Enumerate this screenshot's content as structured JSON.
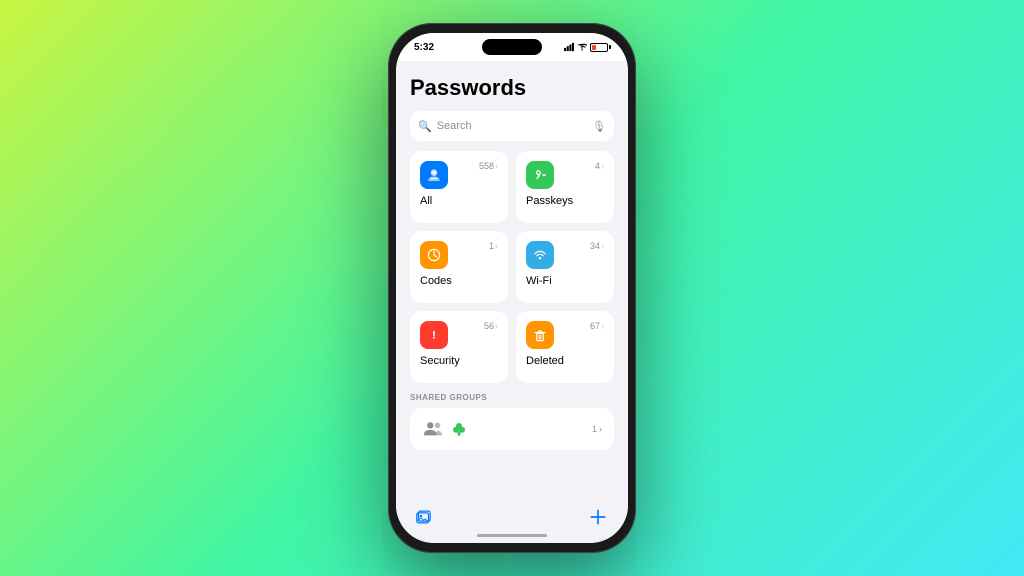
{
  "background": {
    "gradient_start": "#c8f542",
    "gradient_end": "#42e8f5"
  },
  "status_bar": {
    "time": "5:32",
    "battery_level": "low"
  },
  "page": {
    "title": "Passwords"
  },
  "search": {
    "placeholder": "Search"
  },
  "grid_items": [
    {
      "id": "all",
      "label": "All",
      "count": "558",
      "icon_color": "blue",
      "icon_char": "🔑"
    },
    {
      "id": "passkeys",
      "label": "Passkeys",
      "count": "4",
      "icon_color": "green",
      "icon_char": "🔐"
    },
    {
      "id": "codes",
      "label": "Codes",
      "count": "1",
      "icon_color": "yellow",
      "icon_char": "⏱"
    },
    {
      "id": "wifi",
      "label": "Wi-Fi",
      "count": "34",
      "icon_color": "teal",
      "icon_char": "📶"
    },
    {
      "id": "security",
      "label": "Security",
      "count": "56",
      "icon_color": "red",
      "icon_char": "⚠️"
    },
    {
      "id": "deleted",
      "label": "Deleted",
      "count": "67",
      "icon_color": "orange",
      "icon_char": "🗑"
    }
  ],
  "shared_groups": {
    "header": "SHARED GROUPS",
    "count": "1"
  },
  "bottom_bar": {
    "left_icon": "photo-library-icon",
    "right_icon": "add-icon"
  }
}
